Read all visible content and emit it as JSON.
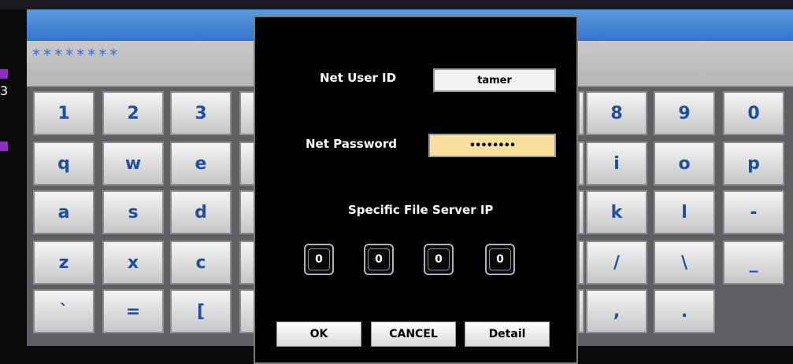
{
  "entry": {
    "masked_text": "********"
  },
  "keyboard": {
    "left_keys": [
      [
        "1",
        "2",
        "3"
      ],
      [
        "q",
        "w",
        "e"
      ],
      [
        "a",
        "s",
        "d"
      ],
      [
        "z",
        "x",
        "c"
      ],
      [
        "`",
        "=",
        "["
      ]
    ],
    "right_keys": [
      [
        "8",
        "9",
        "0"
      ],
      [
        "i",
        "o",
        "p"
      ],
      [
        "k",
        "l",
        "-"
      ],
      [
        "/",
        "\\",
        "_"
      ],
      [
        ",",
        ".",
        ""
      ]
    ]
  },
  "dialog": {
    "net_user_id_label": "Net User ID",
    "net_user_id_value": "tamer",
    "net_password_label": "Net Password",
    "net_password_value": "••••••••",
    "file_server_ip_label": "Specific File Server IP",
    "ip_octets": [
      "0",
      "0",
      "0",
      "0"
    ],
    "ok_label": "OK",
    "cancel_label": "CANCEL",
    "detail_label": "Detail"
  },
  "colors": {
    "top_bar": "#2e6fc6",
    "password_field_bg": "#f9dfa0",
    "user_field_bg": "#f2f2f2",
    "key_text": "#1f4fa0",
    "side_accent": "#8a2fbf"
  }
}
